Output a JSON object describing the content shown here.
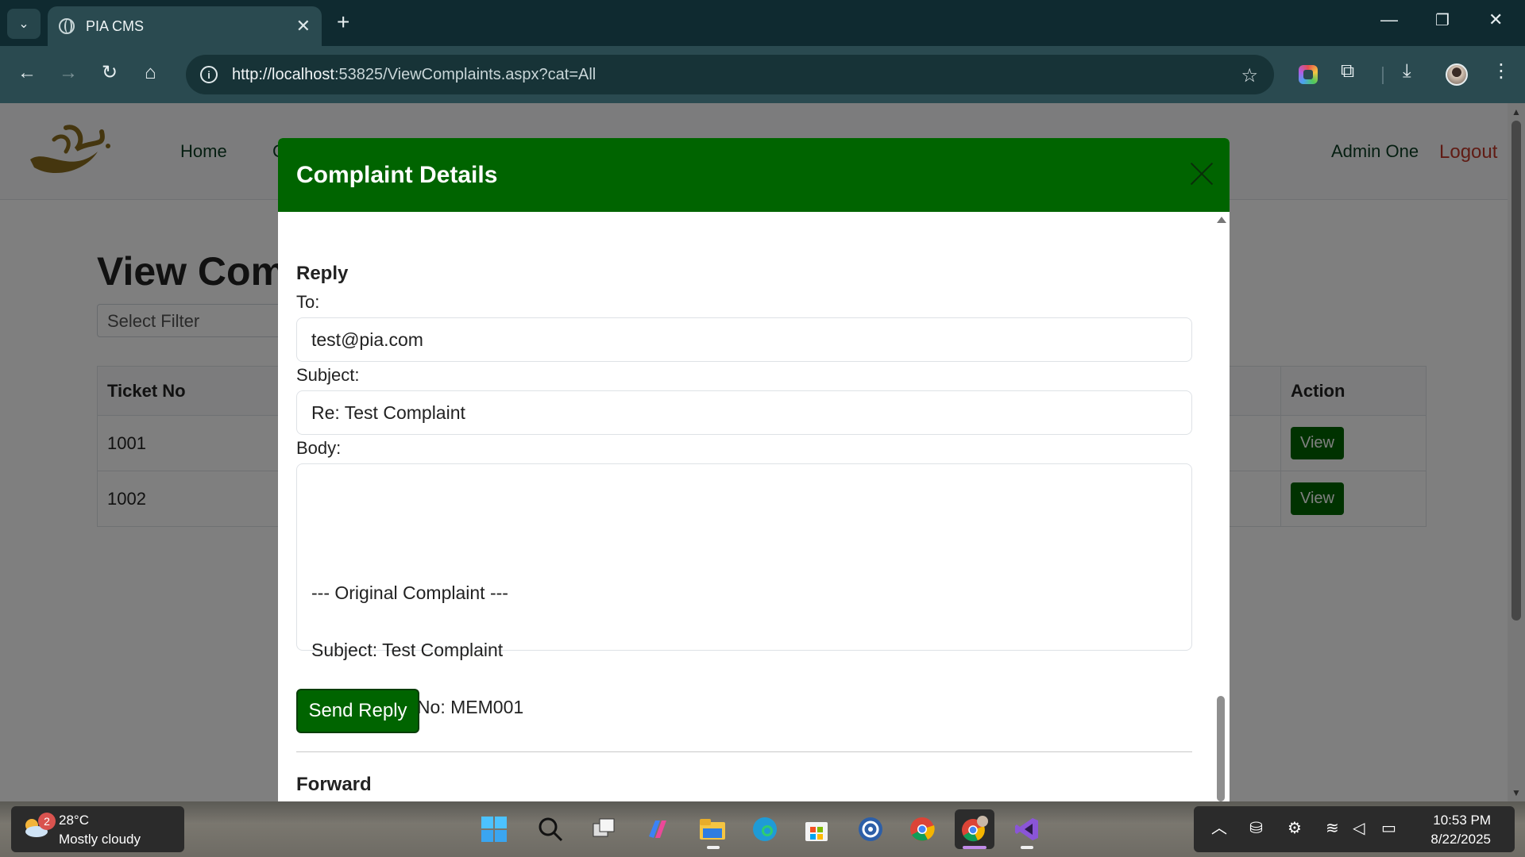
{
  "browser": {
    "tab_title": "PIA CMS",
    "url_host": "http://localhost",
    "url_rest": ":53825/ViewComplaints.aspx?cat=All"
  },
  "page": {
    "nav": {
      "home": "Home",
      "partial_link": "C",
      "admin_name": "Admin One",
      "logout": "Logout"
    },
    "title": "View Comp",
    "filter_placeholder": "Select Filter",
    "table": {
      "headers": [
        "Ticket No",
        "Action"
      ],
      "rows": [
        {
          "ticket_no": "1001",
          "action": "View"
        },
        {
          "ticket_no": "1002",
          "action": "View"
        }
      ]
    }
  },
  "modal": {
    "title": "Complaint Details",
    "reply": {
      "section_title": "Reply",
      "to_label": "To:",
      "to_value": "test@pia.com",
      "subject_label": "Subject:",
      "subject_value": "Re: Test Complaint",
      "body_label": "Body:",
      "body_line1": "--- Original Complaint ---",
      "body_line2": "Subject: Test Complaint",
      "body_line3": "Membership No: MEM001",
      "send_label": "Send Reply"
    },
    "forward": {
      "section_title": "Forward"
    }
  },
  "taskbar": {
    "weather_temp": "28°C",
    "weather_desc": "Mostly cloudy",
    "weather_badge": "2",
    "time": "10:53 PM",
    "date": "8/22/2025"
  },
  "colors": {
    "primary_green": "#006400",
    "logout_red": "#c0392b",
    "chrome_dark": "#0f2a30",
    "chrome_toolbar": "#2a4a50"
  }
}
